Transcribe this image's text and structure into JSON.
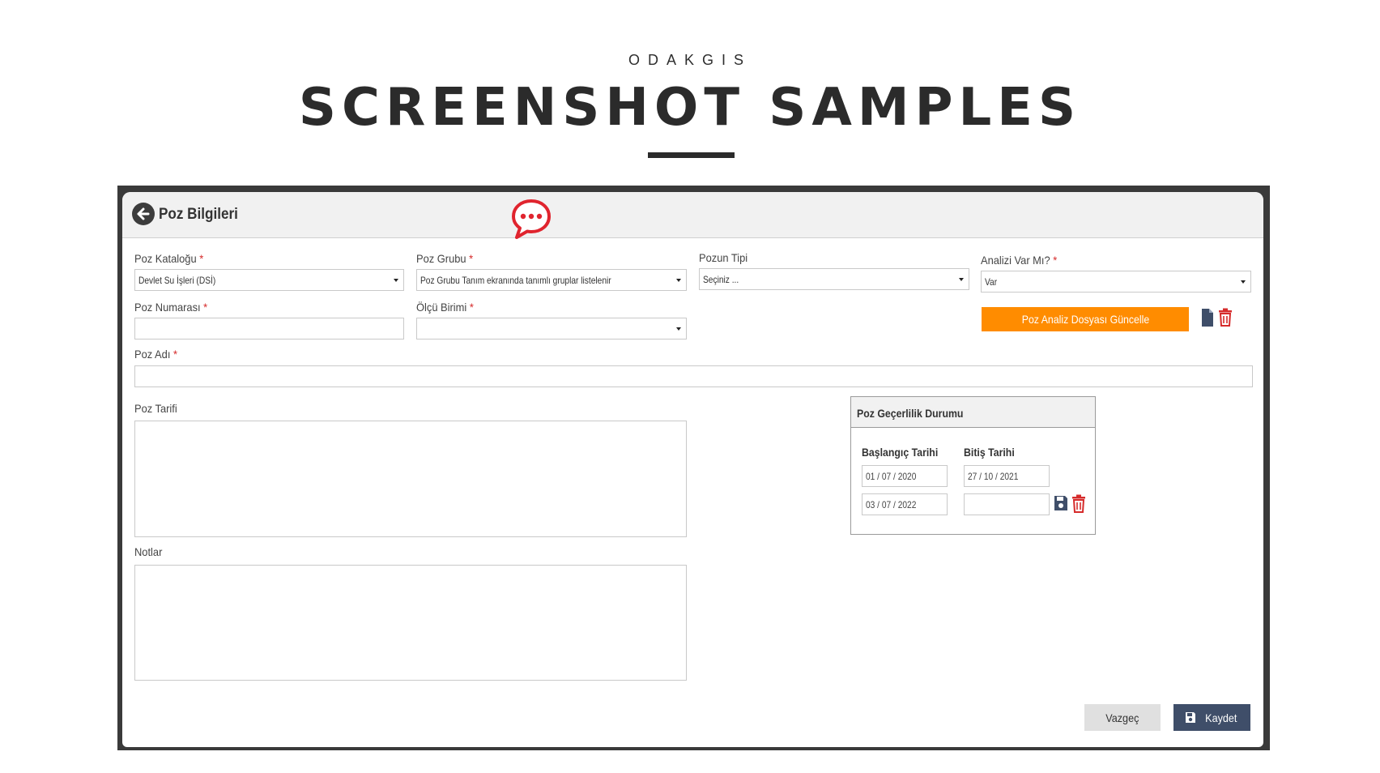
{
  "page": {
    "brand": "ODAKGIS",
    "headline": "SCREENSHOT SAMPLES"
  },
  "panel": {
    "title": "Poz Bilgileri"
  },
  "form": {
    "required_mark": "*",
    "catalog": {
      "label": "Poz Kataloğu",
      "value": "Devlet Su İşleri (DSİ)"
    },
    "group": {
      "label": "Poz Grubu",
      "value": "Poz Grubu Tanım ekranında tanımlı gruplar listelenir"
    },
    "type": {
      "label": "Pozun Tipi",
      "value": "Seçiniz ..."
    },
    "analysis": {
      "label": "Analizi Var Mı?",
      "value": "Var"
    },
    "number": {
      "label": "Poz Numarası",
      "value": ""
    },
    "unit": {
      "label": "Ölçü Birimi",
      "value": ""
    },
    "name": {
      "label": "Poz Adı",
      "value": ""
    },
    "description": {
      "label": "Poz Tarifi",
      "value": ""
    },
    "notes": {
      "label": "Notlar",
      "value": ""
    },
    "update_analysis_button": "Poz Analiz Dosyası Güncelle"
  },
  "validity": {
    "title": "Poz Geçerlilik Durumu",
    "start_label": "Başlangıç Tarihi",
    "end_label": "Bitiş Tarihi",
    "rows": [
      {
        "start": "01 / 07 / 2020",
        "end": "27 / 10 / 2021"
      },
      {
        "start": "03 / 07 / 2022",
        "end": ""
      }
    ]
  },
  "actions": {
    "cancel": "Vazgeç",
    "save": "Kaydet"
  },
  "colors": {
    "accent_orange": "#ff8c00",
    "danger_red": "#d62b2b",
    "primary_navy": "#3f4e69"
  }
}
